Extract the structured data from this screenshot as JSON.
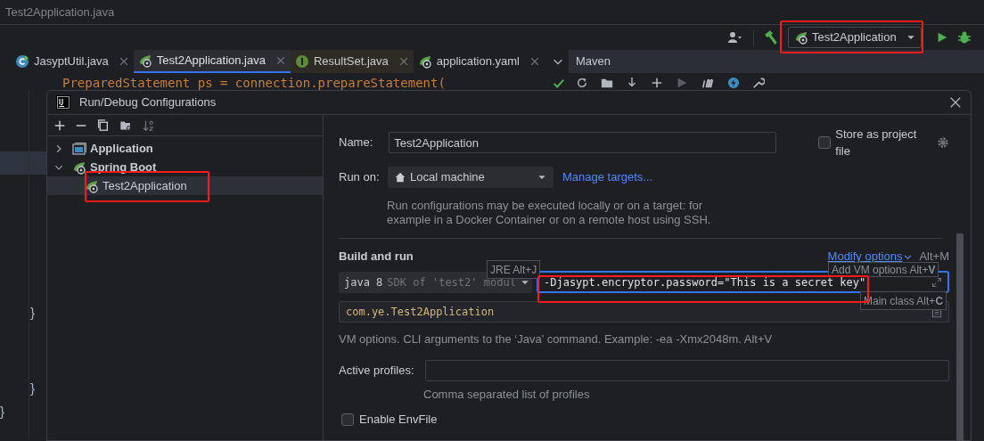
{
  "title_bar": {
    "title": "Test2Application.java"
  },
  "toolbar": {
    "run_config": "Test2Application"
  },
  "editor_tabs": [
    {
      "label": "JasyptUtil.java",
      "kind": "class",
      "selected": false
    },
    {
      "label": "Test2Application.java",
      "kind": "spring",
      "selected": true
    },
    {
      "label": "ResultSet.java",
      "kind": "interface",
      "selected": false
    },
    {
      "label": "application.yaml",
      "kind": "yaml",
      "selected": false
    }
  ],
  "tool_window": {
    "title": "Maven"
  },
  "editor": {
    "code_line": "PreparedStatement ps = connection.prepareStatement(",
    "braces": [
      "}",
      "}",
      "}"
    ]
  },
  "dialog": {
    "title": "Run/Debug Configurations",
    "tree": [
      {
        "label": "Application",
        "kind": "application",
        "expanded": false
      },
      {
        "label": "Spring Boot",
        "kind": "spring",
        "expanded": true,
        "children": [
          {
            "label": "Test2Application",
            "kind": "spring",
            "selected": true
          }
        ]
      }
    ],
    "name_label": "Name:",
    "name_value": "Test2Application",
    "store_label": "Store as project file",
    "store_checked": false,
    "run_on_label": "Run on:",
    "run_on_value": "Local machine",
    "manage_link": "Manage targets...",
    "run_on_hint": "Run configurations may be executed locally or on a target: for example in a Docker Container or on a remote host using SSH.",
    "section_title": "Build and run",
    "modify_options": "Modify options",
    "modify_shortcut": "Alt+M",
    "jre_tooltip": "JRE Alt+J",
    "sdk_value": "java 8",
    "sdk_hint": "SDK of 'test2' modul",
    "vm_options": "-Djasypt.encryptor.password=\"This is a secret key\"",
    "vm_tooltip": "Add VM options Alt+**V**",
    "main_tooltip": "Main class Alt+**C**",
    "main_class": "com.ye.Test2Application",
    "vm_hint": "VM options. CLI arguments to the ‘Java’ command. Example: -ea -Xmx2048m. Alt+V",
    "profiles_label": "Active profiles:",
    "profiles_hint": "Comma separated list of profiles",
    "envfile_label": "Enable EnvFile",
    "envfile_checked": false
  }
}
